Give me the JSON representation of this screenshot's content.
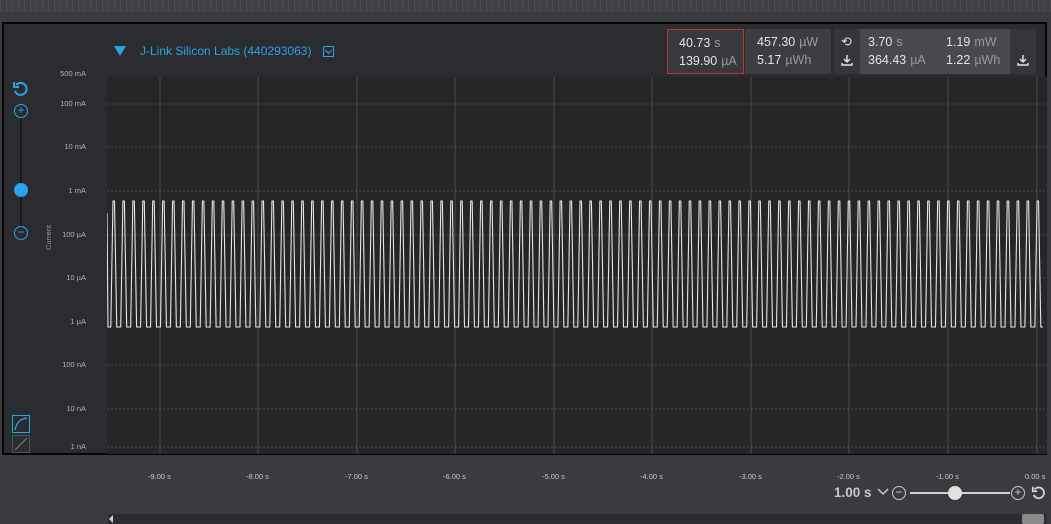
{
  "device": {
    "name": "J-Link Silicon Labs (440293063)"
  },
  "stats": {
    "selection": {
      "time_value": "40.73",
      "time_unit": "s",
      "current_value": "139.90",
      "current_unit": "µA"
    },
    "selection_power": {
      "power_value": "457.30",
      "power_unit": "µW",
      "energy_value": "5.17",
      "energy_unit": "µWh"
    },
    "total": {
      "time_value": "3.70",
      "time_unit": "s",
      "current_value": "364.43",
      "current_unit": "µA",
      "power_value": "1.19",
      "power_unit": "mW",
      "energy_value": "1.22",
      "energy_unit": "µWh"
    }
  },
  "y_axis": {
    "label": "Current",
    "ticks": [
      "500 mA",
      "100 mA",
      "10 mA",
      "1 mA",
      "100 µA",
      "10 µA",
      "1 µA",
      "100 nA",
      "10 nA",
      "1 nA"
    ]
  },
  "x_axis": {
    "ticks": [
      "-9.00 s",
      "-8.00 s",
      "-7.00 s",
      "-6.00 s",
      "-5.00 s",
      "-4.00 s",
      "-3.00 s",
      "-2.00 s",
      "-1.00 s",
      "0.00 s"
    ]
  },
  "zoom": {
    "value": "1.00 s",
    "level": 0.45
  },
  "waveform": {
    "pulse_count": 94,
    "high": "1 mA",
    "low": "1 µA"
  },
  "colors": {
    "accent": "#27a5e8",
    "trace": "#e6e6e6",
    "selection_border": "#c0333a"
  },
  "icons": {
    "device_toggle": "triangle-down-icon",
    "dropdown": "dropdown-icon",
    "reset": "reset-icon",
    "export": "export-icon",
    "zoom_in": "zoom-in-icon",
    "zoom_out": "zoom-out-icon"
  }
}
